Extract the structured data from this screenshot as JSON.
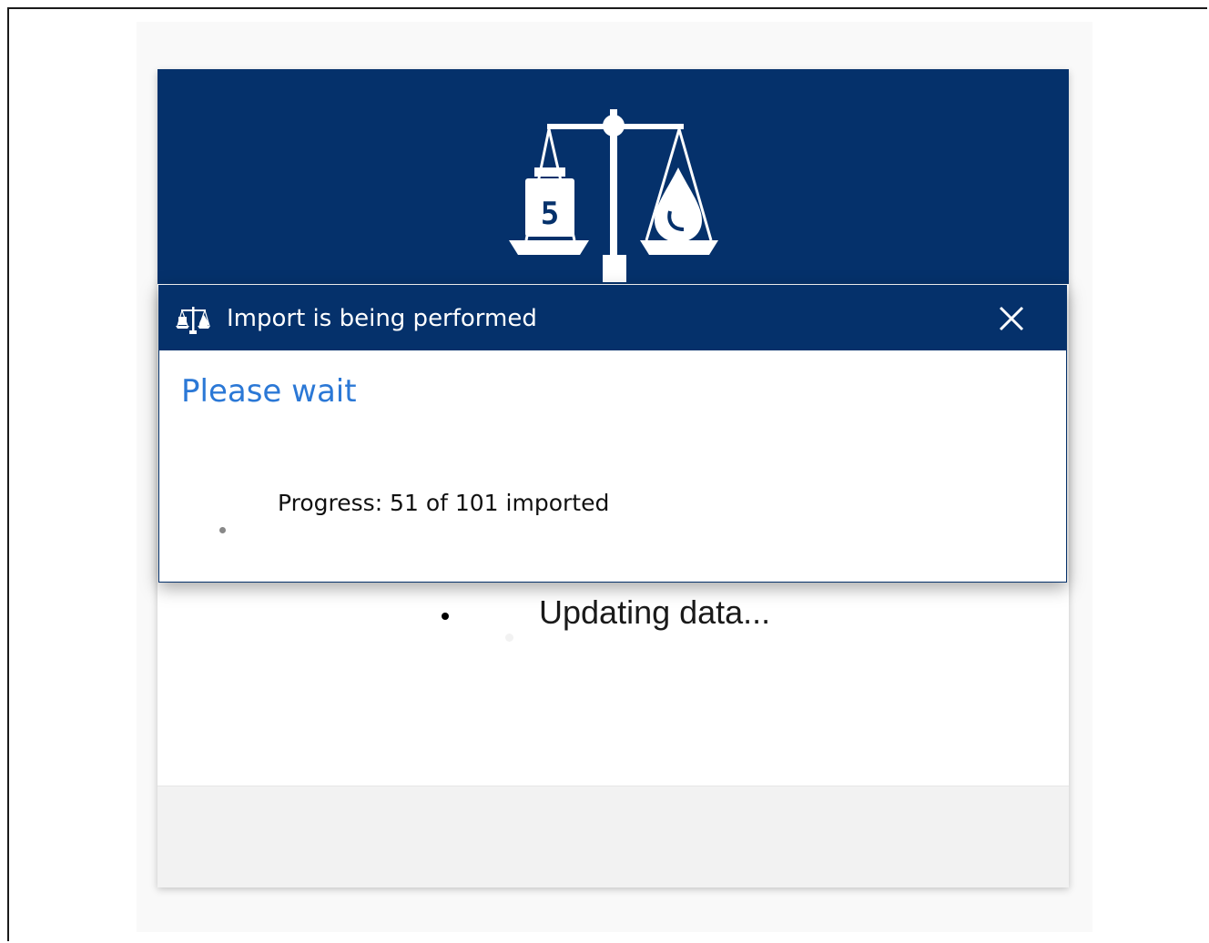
{
  "app": {
    "logo_icon": "balance-scale-icon",
    "weight_label": "5",
    "header_color": "#05316b",
    "status_text": "Updating data..."
  },
  "dialog": {
    "icon": "balance-scale-icon",
    "title": "Import is being performed",
    "close_icon": "close-icon",
    "heading": "Please wait",
    "heading_color": "#2b78d6",
    "progress_text": "Progress: 51 of 101 imported",
    "progress": {
      "done": 51,
      "total": 101
    }
  }
}
